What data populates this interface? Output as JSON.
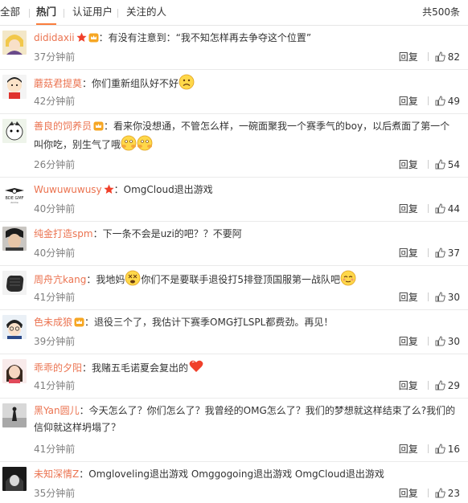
{
  "tabs": [
    {
      "label": "全部"
    },
    {
      "label": "热门"
    },
    {
      "label": "认证用户"
    },
    {
      "label": "关注的人"
    }
  ],
  "total": "共500条",
  "reply_label": "回复",
  "icons": {
    "like": "thumbs-up-icon",
    "vip": "star-vip-icon",
    "member": "member-crown-icon"
  },
  "colors": {
    "username": "#eb7350",
    "active_tab_underline": "#fa7d3c",
    "time": "#808080",
    "text": "#333333"
  },
  "comments": [
    {
      "user": "dididaxii",
      "badges": [
        "star-vip-icon",
        "member-crown-icon"
      ],
      "text": "：有没有注意到：“我不知怎样再去争夺这个位置”",
      "text2": "",
      "emoji": [],
      "time": "37分钟前",
      "likes": "82"
    },
    {
      "user": "蘑菇君提莫",
      "badges": [],
      "text": "：你们重新组队好不好",
      "text2": "",
      "emoji": [
        "sad-face-emoji"
      ],
      "time": "42分钟前",
      "likes": "49"
    },
    {
      "user": "善良的饲养员",
      "badges": [
        "member-crown-icon"
      ],
      "text": "：看来你没想通，不管怎么样，一碗面聚我一个赛季气的boy，以后煮面了第一个",
      "text2": "叫你吃，别生气了哦",
      "emoji": [
        "hug-emoji",
        "hug-emoji"
      ],
      "time": "26分钟前",
      "likes": "54"
    },
    {
      "user": "Wuwuwuwusy",
      "badges": [
        "star-vip-icon"
      ],
      "text": "：OmgCloud退出游戏",
      "text2": "",
      "emoji": [],
      "time": "40分钟前",
      "likes": "44"
    },
    {
      "user": "纯金打造spm",
      "badges": [],
      "text": "：下一条不会是uzi的吧？？不要阿",
      "text2": "",
      "emoji": [],
      "time": "40分钟前",
      "likes": "37"
    },
    {
      "user": "周舟亢kang",
      "badges": [],
      "text_a": "：我地妈",
      "text_b": "你们不是要联手退役打5排登顶国服第一战队吧",
      "text": "",
      "text2": "",
      "emoji": [
        "dizzy-emoji",
        "shy-emoji"
      ],
      "time": "41分钟前",
      "likes": "30"
    },
    {
      "user": "色未成狼",
      "badges": [
        "member-crown-icon"
      ],
      "text": "：退役三个了，我估计下赛季OMG打LSPL都费劲。再见！",
      "text2": "",
      "emoji": [],
      "time": "39分钟前",
      "likes": "30"
    },
    {
      "user": "乖乖的夕阳",
      "badges": [],
      "text": "：我赌五毛诺夏会复出的",
      "text2": "",
      "emoji": [
        "heart-emoji"
      ],
      "time": "41分钟前",
      "likes": "29"
    },
    {
      "user": "黑Yan圆儿",
      "badges": [],
      "text": "：今天怎么了？你们怎么了？我曾经的OMG怎么了？我们的梦想就这样结束了么?我们的",
      "text2": "信仰就这样坍塌了？",
      "emoji": [],
      "time": "41分钟前",
      "likes": "16"
    },
    {
      "user": "未知深情Z",
      "badges": [],
      "text": "：Omgloveling退出游戏 Omggogoing退出游戏 OmgCloud退出游戏",
      "text2": "",
      "emoji": [],
      "time": "35分钟前",
      "likes": "23"
    }
  ]
}
